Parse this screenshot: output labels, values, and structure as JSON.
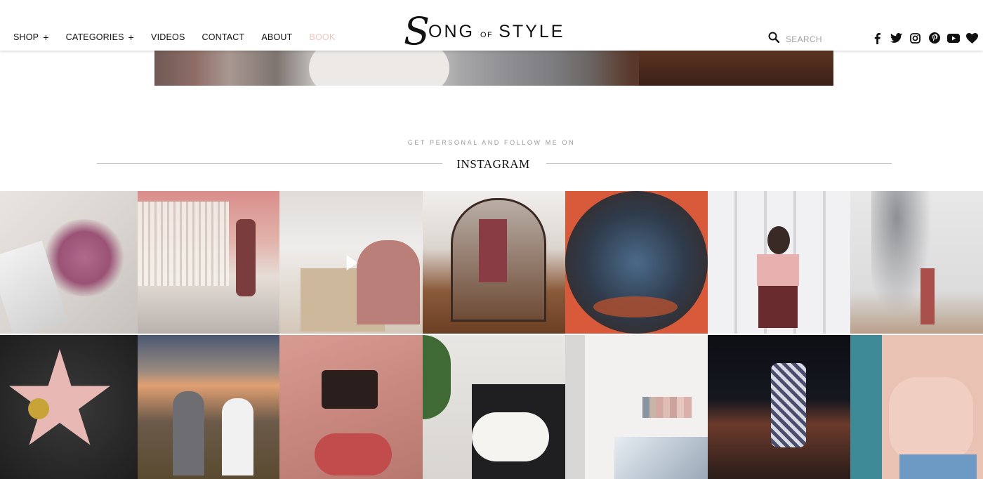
{
  "nav": {
    "items": [
      {
        "label": "SHOP",
        "has_plus": true
      },
      {
        "label": "CATEGORIES",
        "has_plus": true
      },
      {
        "label": "VIDEOS",
        "has_plus": false
      },
      {
        "label": "CONTACT",
        "has_plus": false
      },
      {
        "label": "ABOUT",
        "has_plus": false
      },
      {
        "label": "BOOK",
        "has_plus": false,
        "accent": "#f0c4bd"
      }
    ],
    "plus_glyph": "+"
  },
  "logo": {
    "s": "S",
    "ong": "ONG",
    "of": "OF",
    "style": "STYLE"
  },
  "search": {
    "placeholder": "SEARCH",
    "icon": "search-icon"
  },
  "social": [
    "facebook-icon",
    "twitter-icon",
    "instagram-icon",
    "pinterest-icon",
    "youtube-icon",
    "heart-icon"
  ],
  "instagram": {
    "eyebrow": "GET PERSONAL AND FOLLOW ME ON",
    "title": "INSTAGRAM",
    "posts": [
      {
        "desc": "pink roses on paint tubes",
        "video": false
      },
      {
        "desc": "woman in pink patio",
        "video": false
      },
      {
        "desc": "unboxing video",
        "video": true
      },
      {
        "desc": "mirror selfie in boots",
        "video": false
      },
      {
        "desc": "sunglasses city view",
        "video": false
      },
      {
        "desc": "woman white lattice wall",
        "video": false
      },
      {
        "desc": "tree shadow wall",
        "video": false
      },
      {
        "desc": "walk of fame star",
        "video": false
      },
      {
        "desc": "sunset hike",
        "video": false
      },
      {
        "desc": "bag on pink sofa",
        "video": false
      },
      {
        "desc": "dog on sofa",
        "video": false
      },
      {
        "desc": "paint swatches on wall",
        "video": false
      },
      {
        "desc": "rooftop at night",
        "video": false
      },
      {
        "desc": "silk blouse",
        "video": false
      }
    ]
  },
  "colors": {
    "accent": "#f0c4bd",
    "text": "#111111",
    "rule": "#b9b9b9"
  }
}
